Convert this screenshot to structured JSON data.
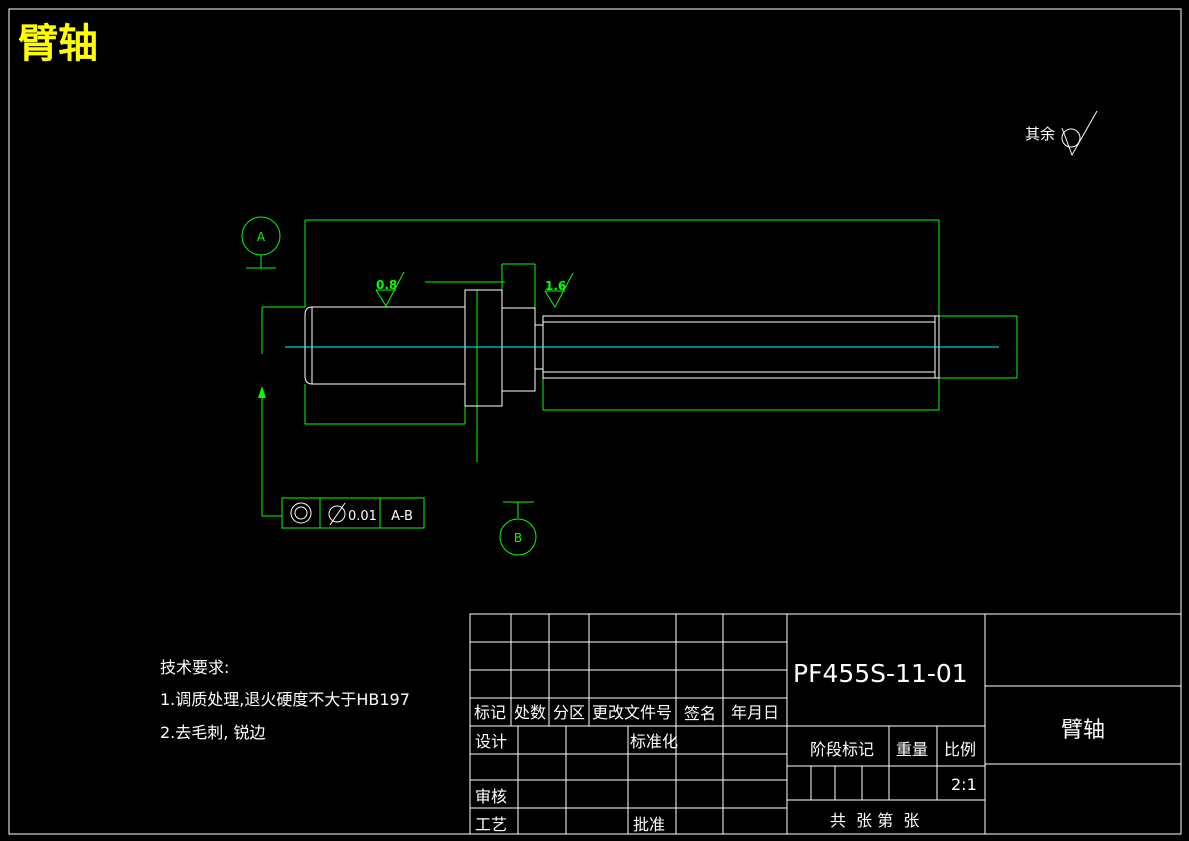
{
  "drawing_title": "臂轴",
  "surface_finish_note": "其余",
  "datums": {
    "a": "A",
    "b": "B"
  },
  "roughness": {
    "left": "0.8",
    "right": "1.6"
  },
  "tolerance_frame": {
    "value": "0.01",
    "datum_ref": "A-B"
  },
  "tech_requirements": {
    "heading": "技术要求:",
    "items": [
      "1.调质处理,退火硬度不大于HB197",
      "2.去毛刺, 锐边"
    ]
  },
  "title_block": {
    "drawing_number": "PF455S-11-01",
    "part_name": "臂轴",
    "revision_headers": [
      "标记",
      "处数",
      "分区",
      "更改文件号",
      "签名",
      "年月日"
    ],
    "design": "设计",
    "standardization": "标准化",
    "review": "审核",
    "process": "工艺",
    "approve": "批准",
    "stage_mark": "阶段标记",
    "weight": "重量",
    "scale_label": "比例",
    "scale_value": "2:1",
    "sheets": "共  张 第  张"
  },
  "colors": {
    "frame": "#ffffff",
    "dimension": "#00ff00",
    "title": "#ffff00",
    "part_outline": "#ffffff",
    "centerline": "#00ffff",
    "text": "#ffffff"
  }
}
